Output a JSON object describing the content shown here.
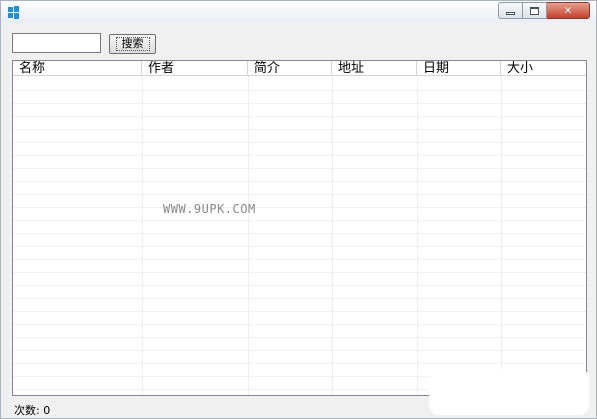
{
  "window": {
    "title": ""
  },
  "search": {
    "placeholder": "",
    "value": "",
    "button_label": "搜索"
  },
  "table": {
    "columns": [
      "名称",
      "作者",
      "简介",
      "地址",
      "日期",
      "大小"
    ],
    "rows": []
  },
  "watermark": "WWW.9UPK.COM",
  "status": {
    "count_label": "次数: 0"
  },
  "icons": {
    "app": "windows-logo-icon",
    "minimize": "minimize-icon",
    "maximize": "maximize-icon",
    "close": "close-icon"
  }
}
